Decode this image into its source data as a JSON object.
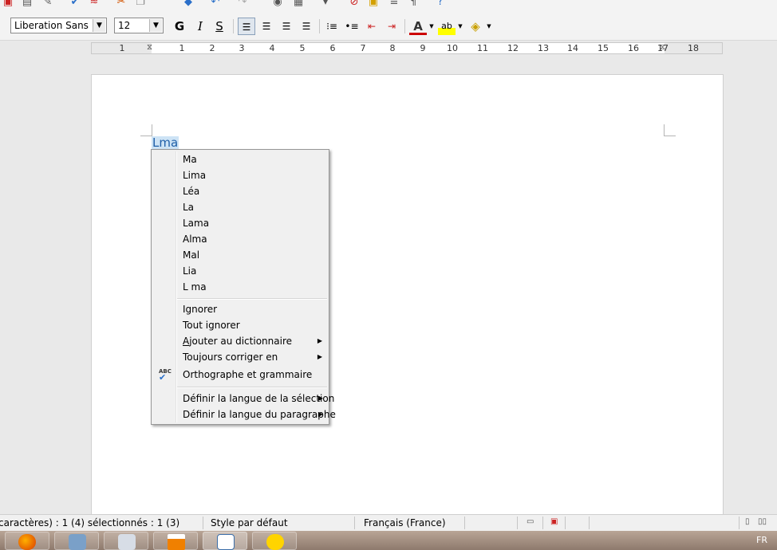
{
  "toolbar": {
    "font_name": "Liberation Sans",
    "font_size": "12",
    "bold_label": "G",
    "italic_label": "I",
    "strike_label": "S"
  },
  "ruler": {
    "numbers": [
      "1",
      "1",
      "2",
      "3",
      "4",
      "5",
      "6",
      "7",
      "8",
      "9",
      "10",
      "11",
      "12",
      "13",
      "14",
      "15",
      "16",
      "17",
      "18"
    ]
  },
  "document": {
    "selected_word": "Lma"
  },
  "context_menu": {
    "suggestions": [
      "Ma",
      "Lima",
      "Léa",
      "La",
      "Lama",
      "Alma",
      "Mal",
      "Lia",
      "L ma"
    ],
    "ignore": "Ignorer",
    "ignore_all": "Tout ignorer",
    "add_to_dictionary_mnemonic": "A",
    "add_to_dictionary_rest": "jouter au dictionnaire",
    "always_correct": "Toujours corriger en",
    "spelling_grammar": "Orthographe et grammaire",
    "set_selection_language": "Définir la langue de la sélection",
    "set_paragraph_language": "Définir la langue du paragraphe"
  },
  "statusbar": {
    "word_count": "caractères) : 1 (4) sélectionnés : 1 (3)",
    "page_style": "Style par défaut",
    "language": "Français (France)"
  },
  "taskbar": {
    "language_indicator": "FR"
  }
}
